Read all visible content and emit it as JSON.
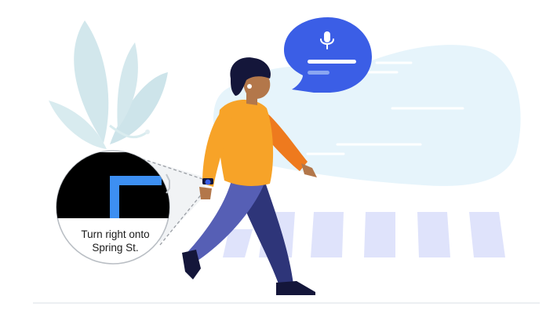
{
  "watch": {
    "line1": "Turn right onto",
    "line2": "Spring St."
  },
  "colors": {
    "background": "#ffffff",
    "cloud": "#e6f4fb",
    "bubble": "#3b5ee6",
    "crosswalk": "#dfe3fb",
    "sweater": "#f7a328",
    "sweater_shadow": "#ee7a1e",
    "pants": "#565fb5",
    "pants_dark": "#2e3579",
    "skin": "#b3774a",
    "hair": "#14163a",
    "leaves": "#cfe7ec"
  },
  "icons": [
    "microphone-icon",
    "right-turn-arrow-icon"
  ]
}
